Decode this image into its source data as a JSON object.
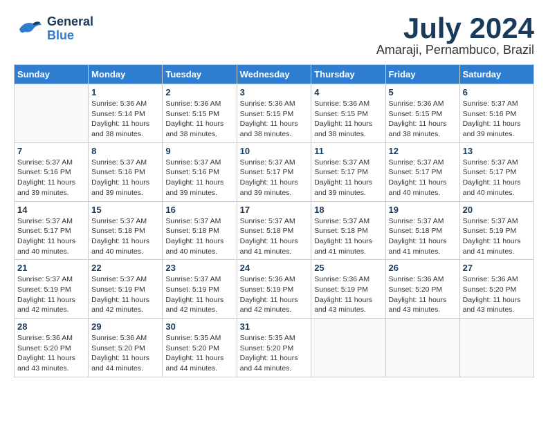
{
  "header": {
    "logo_general": "General",
    "logo_blue": "Blue",
    "month_year": "July 2024",
    "location": "Amaraji, Pernambuco, Brazil"
  },
  "weekdays": [
    "Sunday",
    "Monday",
    "Tuesday",
    "Wednesday",
    "Thursday",
    "Friday",
    "Saturday"
  ],
  "weeks": [
    [
      {
        "day": "",
        "info": ""
      },
      {
        "day": "1",
        "info": "Sunrise: 5:36 AM\nSunset: 5:14 PM\nDaylight: 11 hours\nand 38 minutes."
      },
      {
        "day": "2",
        "info": "Sunrise: 5:36 AM\nSunset: 5:15 PM\nDaylight: 11 hours\nand 38 minutes."
      },
      {
        "day": "3",
        "info": "Sunrise: 5:36 AM\nSunset: 5:15 PM\nDaylight: 11 hours\nand 38 minutes."
      },
      {
        "day": "4",
        "info": "Sunrise: 5:36 AM\nSunset: 5:15 PM\nDaylight: 11 hours\nand 38 minutes."
      },
      {
        "day": "5",
        "info": "Sunrise: 5:36 AM\nSunset: 5:15 PM\nDaylight: 11 hours\nand 38 minutes."
      },
      {
        "day": "6",
        "info": "Sunrise: 5:37 AM\nSunset: 5:16 PM\nDaylight: 11 hours\nand 39 minutes."
      }
    ],
    [
      {
        "day": "7",
        "info": "Sunrise: 5:37 AM\nSunset: 5:16 PM\nDaylight: 11 hours\nand 39 minutes."
      },
      {
        "day": "8",
        "info": "Sunrise: 5:37 AM\nSunset: 5:16 PM\nDaylight: 11 hours\nand 39 minutes."
      },
      {
        "day": "9",
        "info": "Sunrise: 5:37 AM\nSunset: 5:16 PM\nDaylight: 11 hours\nand 39 minutes."
      },
      {
        "day": "10",
        "info": "Sunrise: 5:37 AM\nSunset: 5:17 PM\nDaylight: 11 hours\nand 39 minutes."
      },
      {
        "day": "11",
        "info": "Sunrise: 5:37 AM\nSunset: 5:17 PM\nDaylight: 11 hours\nand 39 minutes."
      },
      {
        "day": "12",
        "info": "Sunrise: 5:37 AM\nSunset: 5:17 PM\nDaylight: 11 hours\nand 40 minutes."
      },
      {
        "day": "13",
        "info": "Sunrise: 5:37 AM\nSunset: 5:17 PM\nDaylight: 11 hours\nand 40 minutes."
      }
    ],
    [
      {
        "day": "14",
        "info": "Sunrise: 5:37 AM\nSunset: 5:17 PM\nDaylight: 11 hours\nand 40 minutes."
      },
      {
        "day": "15",
        "info": "Sunrise: 5:37 AM\nSunset: 5:18 PM\nDaylight: 11 hours\nand 40 minutes."
      },
      {
        "day": "16",
        "info": "Sunrise: 5:37 AM\nSunset: 5:18 PM\nDaylight: 11 hours\nand 40 minutes."
      },
      {
        "day": "17",
        "info": "Sunrise: 5:37 AM\nSunset: 5:18 PM\nDaylight: 11 hours\nand 41 minutes."
      },
      {
        "day": "18",
        "info": "Sunrise: 5:37 AM\nSunset: 5:18 PM\nDaylight: 11 hours\nand 41 minutes."
      },
      {
        "day": "19",
        "info": "Sunrise: 5:37 AM\nSunset: 5:18 PM\nDaylight: 11 hours\nand 41 minutes."
      },
      {
        "day": "20",
        "info": "Sunrise: 5:37 AM\nSunset: 5:19 PM\nDaylight: 11 hours\nand 41 minutes."
      }
    ],
    [
      {
        "day": "21",
        "info": "Sunrise: 5:37 AM\nSunset: 5:19 PM\nDaylight: 11 hours\nand 42 minutes."
      },
      {
        "day": "22",
        "info": "Sunrise: 5:37 AM\nSunset: 5:19 PM\nDaylight: 11 hours\nand 42 minutes."
      },
      {
        "day": "23",
        "info": "Sunrise: 5:37 AM\nSunset: 5:19 PM\nDaylight: 11 hours\nand 42 minutes."
      },
      {
        "day": "24",
        "info": "Sunrise: 5:36 AM\nSunset: 5:19 PM\nDaylight: 11 hours\nand 42 minutes."
      },
      {
        "day": "25",
        "info": "Sunrise: 5:36 AM\nSunset: 5:19 PM\nDaylight: 11 hours\nand 43 minutes."
      },
      {
        "day": "26",
        "info": "Sunrise: 5:36 AM\nSunset: 5:20 PM\nDaylight: 11 hours\nand 43 minutes."
      },
      {
        "day": "27",
        "info": "Sunrise: 5:36 AM\nSunset: 5:20 PM\nDaylight: 11 hours\nand 43 minutes."
      }
    ],
    [
      {
        "day": "28",
        "info": "Sunrise: 5:36 AM\nSunset: 5:20 PM\nDaylight: 11 hours\nand 43 minutes."
      },
      {
        "day": "29",
        "info": "Sunrise: 5:36 AM\nSunset: 5:20 PM\nDaylight: 11 hours\nand 44 minutes."
      },
      {
        "day": "30",
        "info": "Sunrise: 5:35 AM\nSunset: 5:20 PM\nDaylight: 11 hours\nand 44 minutes."
      },
      {
        "day": "31",
        "info": "Sunrise: 5:35 AM\nSunset: 5:20 PM\nDaylight: 11 hours\nand 44 minutes."
      },
      {
        "day": "",
        "info": ""
      },
      {
        "day": "",
        "info": ""
      },
      {
        "day": "",
        "info": ""
      }
    ]
  ]
}
